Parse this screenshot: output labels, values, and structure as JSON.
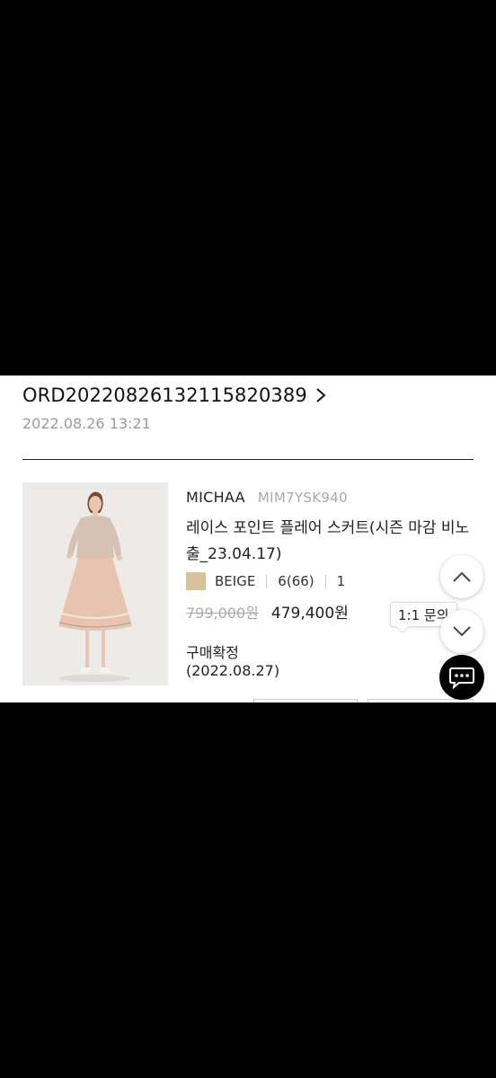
{
  "order": {
    "number": "ORD20220826132115820389",
    "date": "2022.08.26 13:21"
  },
  "product": {
    "brand": "MICHAA",
    "sku": "MIM7YSK940",
    "name": "레이스 포인트 플레어 스커트(시즌 마감 비노출_23.04.17)",
    "color_name": "BEIGE",
    "color_hex": "#d9c19c",
    "size": "6(66)",
    "quantity": "1",
    "original_price": "799,000원",
    "sale_price": "479,400원",
    "status": "구매확정",
    "status_date": "(2022.08.27)"
  },
  "floating": {
    "tooltip_label": "1:1 문의",
    "scroll_up_icon": "chevron-up-icon",
    "scroll_down_icon": "chevron-down-icon",
    "chat_icon": "chat-bubble-icon"
  },
  "colors": {
    "text_primary": "#222222",
    "text_muted": "#9a9a9a",
    "divider": "#222222",
    "chat_button": "#000000"
  }
}
